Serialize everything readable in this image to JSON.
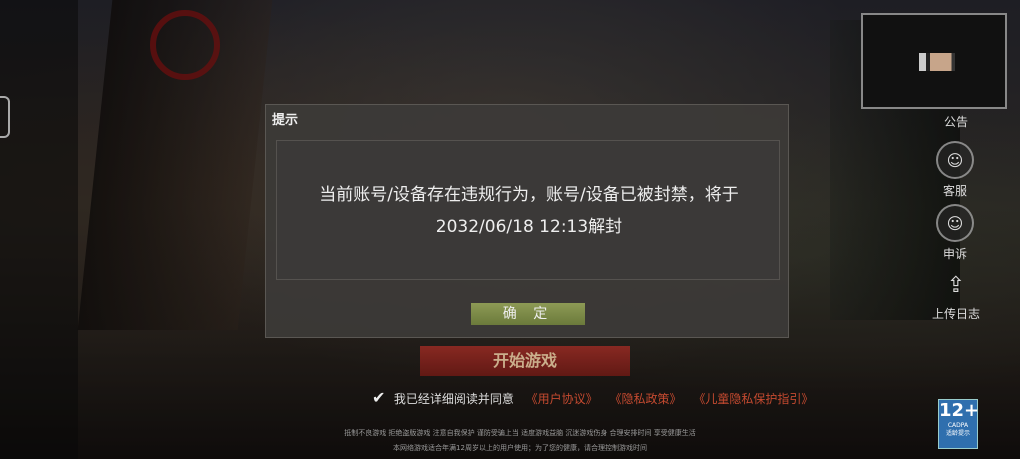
{
  "dialog": {
    "title": "提示",
    "message": "当前账号/设备存在违规行为，账号/设备已被封禁，将于2032/06/18 12:13解封",
    "confirm_label": "确 定"
  },
  "side_menu": {
    "announcement": "公告",
    "service": "客服",
    "appeal": "申诉",
    "upload_log": "上传日志"
  },
  "start_button": "开始游戏",
  "agreement": {
    "text": "我已经详细阅读并同意",
    "links": [
      "《用户协议》",
      "《隐私政策》",
      "《儿童隐私保护指引》"
    ]
  },
  "footer": {
    "line1": "抵制不良游戏 拒绝盗版游戏 注意自我保护 谨防受骗上当 适度游戏益脑 沉迷游戏伤身 合理安排时间 享受健康生活",
    "line2": "本网络游戏适合年满12周岁以上的用户使用；为了您的健康，请合理控制游戏时间"
  },
  "age_rating": {
    "value": "12+",
    "org": "CADPA",
    "note": "适龄提示"
  },
  "colors": {
    "dialog_bg": "#3c3a38",
    "confirm_button": "#7a8746",
    "start_button": "#8a241e",
    "link": "#c54a30"
  }
}
